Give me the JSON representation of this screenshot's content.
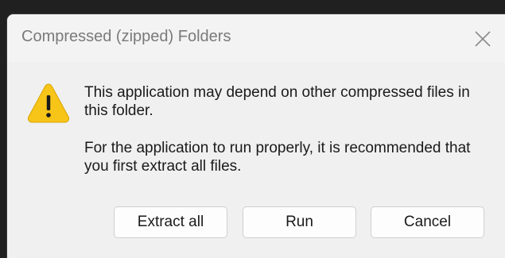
{
  "dialog": {
    "title": "Compressed (zipped) Folders",
    "message_primary": "This application may depend on other compressed files in this folder.",
    "message_secondary": "For the application to run properly, it is recommended that you first extract all files.",
    "icon": "warning-icon",
    "close_icon": "close-icon"
  },
  "buttons": {
    "extract_all": "Extract all",
    "run": "Run",
    "cancel": "Cancel"
  },
  "colors": {
    "warning_yellow": "#F7C418",
    "dialog_background": "#F0F0F0",
    "title_text": "#7A7A7A"
  }
}
